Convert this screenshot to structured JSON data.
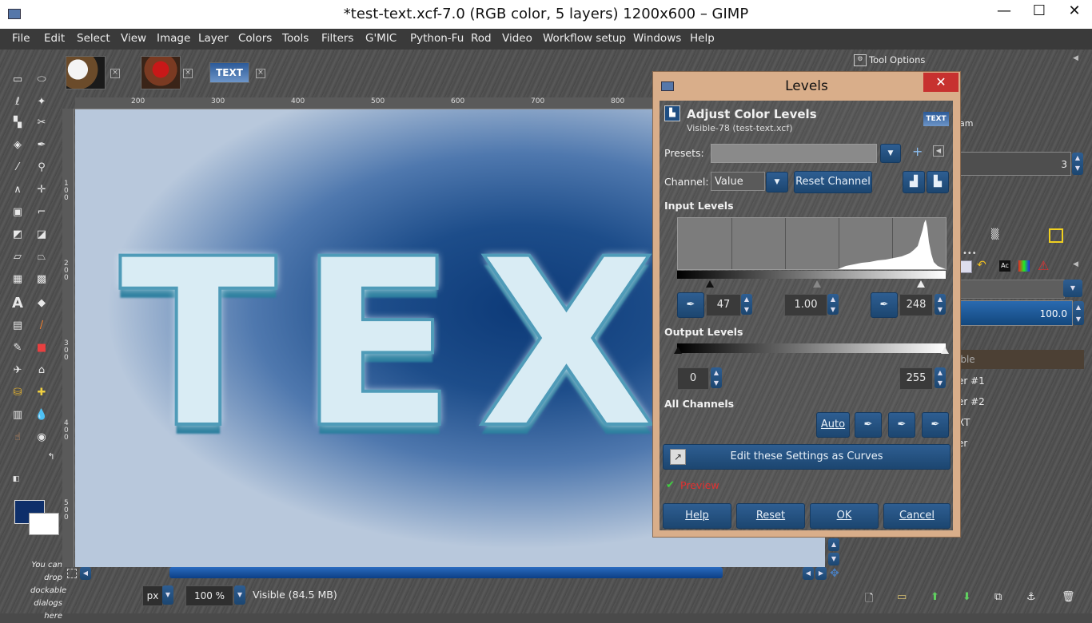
{
  "window": {
    "title": "*test-text.xcf-7.0 (RGB color, 5 layers) 1200x600 – GIMP",
    "minimize": "—",
    "maximize": "☐",
    "close": "✕"
  },
  "menubar": [
    "File",
    "Edit",
    "Select",
    "View",
    "Image",
    "Layer",
    "Colors",
    "Tools",
    "Filters",
    "G'MIC",
    "Python-Fu",
    "Rod",
    "Video",
    "Workflow setup",
    "Windows",
    "Help"
  ],
  "image_tabs": [
    {
      "name": "eagle"
    },
    {
      "name": "roses"
    },
    {
      "name": "TEXT"
    }
  ],
  "canvas": {
    "text": "TEXT"
  },
  "ruler": {
    "h": [
      "200",
      "300",
      "400",
      "500",
      "600",
      "700",
      "800"
    ],
    "v": [
      "100",
      "200",
      "300",
      "400",
      "500"
    ]
  },
  "toolbox": {
    "dock_hint": "You can drop dockable dialogs here"
  },
  "statusbar": {
    "unit": "px",
    "zoom": "100 %",
    "info": "Visible (84.5 MB)"
  },
  "dock": {
    "tool_options": "Tool Options",
    "partial_text": "am",
    "spin_value": "3",
    "opacity_value": "100.0",
    "layers": [
      "ible",
      "er #1",
      "er #2",
      "XT",
      "er"
    ]
  },
  "levels": {
    "title": "Levels",
    "heading": "Adjust Color Levels",
    "subheading": "Visible-78 (test-text.xcf)",
    "presets_label": "Presets:",
    "channel_label": "Channel:",
    "channel_value": "Value",
    "reset_channel": "Reset Channel",
    "input_levels_label": "Input Levels",
    "input_low": "47",
    "input_gamma": "1.00",
    "input_high": "248",
    "output_levels_label": "Output Levels",
    "output_low": "0",
    "output_high": "255",
    "all_channels_label": "All Channels",
    "auto": "Auto",
    "edit_as_curves": "Edit these Settings as Curves",
    "preview": "Preview",
    "help": "Help",
    "reset": "Reset",
    "ok": "OK",
    "cancel": "Cancel",
    "accent_close": "#c7312f"
  }
}
